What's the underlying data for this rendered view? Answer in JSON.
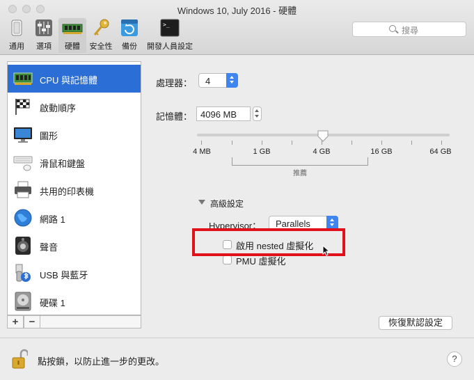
{
  "window": {
    "title": "Windows 10, July 2016 - 硬體"
  },
  "toolbar": {
    "items": [
      {
        "label": "通用",
        "icon": "general-icon"
      },
      {
        "label": "選項",
        "icon": "options-icon"
      },
      {
        "label": "硬體",
        "icon": "hardware-icon",
        "selected": true
      },
      {
        "label": "安全性",
        "icon": "security-key-icon"
      },
      {
        "label": "備份",
        "icon": "backup-icon"
      },
      {
        "label": "開發人員設定",
        "icon": "terminal-icon"
      }
    ]
  },
  "search": {
    "placeholder": "搜尋"
  },
  "sidebar": {
    "items": [
      {
        "label": "CPU 與記憶體",
        "icon": "cpu-memory-icon",
        "selected": true
      },
      {
        "label": "啟動順序",
        "icon": "boot-order-flag-icon"
      },
      {
        "label": "圖形",
        "icon": "graphics-monitor-icon"
      },
      {
        "label": "滑鼠和鍵盤",
        "icon": "mouse-keyboard-icon"
      },
      {
        "label": "共用的印表機",
        "icon": "printer-icon"
      },
      {
        "label": "網路 1",
        "icon": "network-globe-icon"
      },
      {
        "label": "聲音",
        "icon": "speaker-icon"
      },
      {
        "label": "USB 與藍牙",
        "icon": "usb-bluetooth-icon"
      },
      {
        "label": "硬碟 1",
        "icon": "hard-disk-icon"
      }
    ],
    "add_label": "+",
    "remove_label": "−"
  },
  "cpu": {
    "label": "處理器：",
    "value": "4"
  },
  "memory": {
    "label": "記憶體：",
    "value": "4096 MB",
    "slider_position": 0.5,
    "ticks": [
      "4 MB",
      "1 GB",
      "4 GB",
      "16 GB",
      "64 GB"
    ],
    "recommended_label": "推薦"
  },
  "advanced": {
    "label": "高級設定",
    "hypervisor_label": "Hypervisor：",
    "hypervisor_value": "Parallels",
    "nested_label": "啟用 nested 虛擬化",
    "nested_checked": false,
    "pmu_label": "PMU 虛擬化",
    "pmu_checked": false
  },
  "restore_button": "恢復默認設定",
  "footer": {
    "lock_text": "點按鎖，以防止進一步的更改。",
    "help": "?"
  },
  "colors": {
    "selection": "#2a6ed6",
    "accent": "#3d86f0",
    "highlight_box": "#e0111a"
  }
}
